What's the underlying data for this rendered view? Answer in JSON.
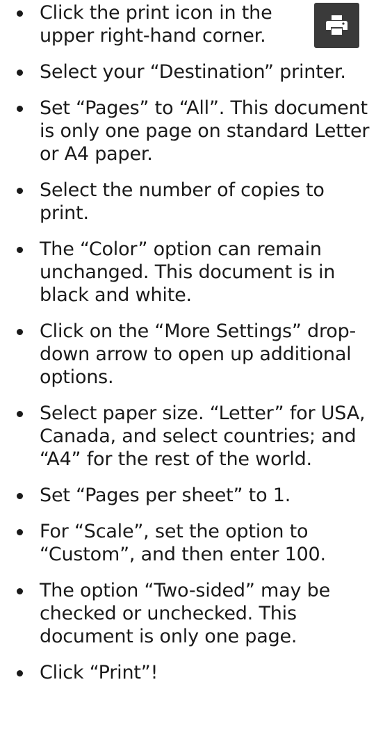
{
  "steps": [
    "Click the print icon in the upper right-hand corner.",
    "Select your “Destination” printer.",
    "Set “Pages” to “All”. This document is only one page on standard Letter or A4 paper.",
    "Select the number of copies to print.",
    "The “Color” option can remain unchanged. This document is in black and white.",
    "Click on the “More Settings” drop-down arrow to open up additional options.",
    "Select paper size. “Letter” for USA, Canada, and select countries; and “A4” for the rest of the world.",
    "Set “Pages per sheet” to 1.",
    "For “Scale”, set the option to “Custom”, and then enter 100.",
    "The option “Two-sided” may be checked or unchecked. This document is only one page.",
    "Click “Print”!"
  ],
  "icons": {
    "print_icon": "print-icon"
  },
  "colors": {
    "text": "#1a1a1a",
    "icon_background": "#3a3a3a",
    "icon_foreground": "#ffffff"
  }
}
